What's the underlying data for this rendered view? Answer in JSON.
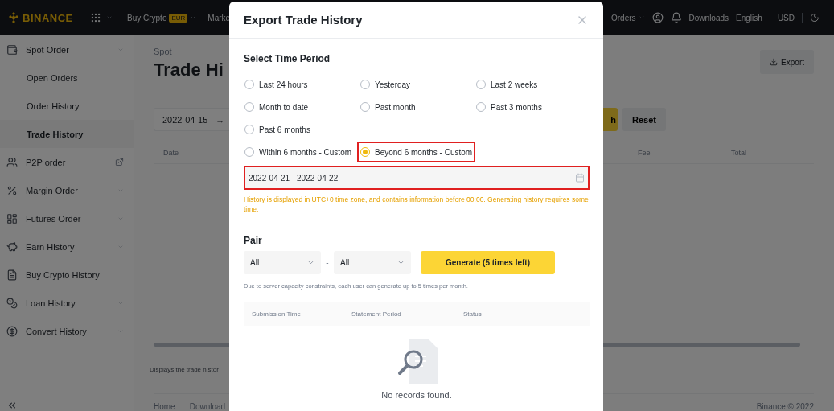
{
  "header": {
    "logo": "BINANCE",
    "nav": [
      {
        "label": "Buy Crypto",
        "badge": "EUR",
        "caret": true
      },
      {
        "label": "Marke",
        "caret": false
      }
    ],
    "orders": "Orders",
    "downloads": "Downloads",
    "language": "English",
    "currency": "USD"
  },
  "sidebar": {
    "items": [
      {
        "label": "Spot Order",
        "kind": "dropdown",
        "selected": false,
        "children": [
          {
            "label": "Open Orders",
            "selected": false
          },
          {
            "label": "Order History",
            "selected": false
          },
          {
            "label": "Trade History",
            "selected": true
          }
        ]
      },
      {
        "label": "P2P order",
        "kind": "external",
        "selected": false
      },
      {
        "label": "Margin Order",
        "kind": "dropdown",
        "selected": false
      },
      {
        "label": "Futures Order",
        "kind": "dropdown",
        "selected": false
      },
      {
        "label": "Earn History",
        "kind": "dropdown",
        "selected": false
      },
      {
        "label": "Buy Crypto History",
        "kind": "link",
        "selected": false
      },
      {
        "label": "Loan History",
        "kind": "dropdown",
        "selected": false
      },
      {
        "label": "Convert History",
        "kind": "dropdown",
        "selected": false
      }
    ]
  },
  "main": {
    "breadcrumb": "Spot",
    "title": "Trade Hi",
    "export": "Export",
    "filter": {
      "date_from": "2022-04-15",
      "arrow": "→",
      "search": "h",
      "reset": "Reset"
    },
    "table": {
      "columns": [
        "Date",
        "Fee",
        "Total"
      ]
    },
    "note": "Displays the trade histor",
    "footer": {
      "links": [
        "Home",
        "Download"
      ],
      "copyright": "Binance © 2022"
    }
  },
  "modal": {
    "title": "Export Trade History",
    "time_period": {
      "label": "Select Time Period",
      "rows": [
        [
          {
            "label": "Last 24 hours",
            "selected": false,
            "highlighted": false
          },
          {
            "label": "Yesterday",
            "selected": false,
            "highlighted": false
          },
          {
            "label": "Last 2 weeks",
            "selected": false,
            "highlighted": false
          }
        ],
        [
          {
            "label": "Month to date",
            "selected": false,
            "highlighted": false
          },
          {
            "label": "Past month",
            "selected": false,
            "highlighted": false
          },
          {
            "label": "Past 3 months",
            "selected": false,
            "highlighted": false
          }
        ],
        [
          {
            "label": "Past 6 months",
            "selected": false,
            "highlighted": false
          }
        ],
        [
          {
            "label": "Within 6 months - Custom",
            "selected": false,
            "highlighted": false
          },
          {
            "label": "Beyond 6 months - Custom",
            "selected": true,
            "highlighted": true
          }
        ]
      ]
    },
    "date_range": {
      "value": "2022-04-21 - 2022-04-22",
      "highlighted": true
    },
    "warning": "History is displayed in UTC+0 time zone, and contains information before 00:00. Generating history requires some time.",
    "pair": {
      "label": "Pair",
      "base": "All",
      "separator": "-",
      "quote": "All"
    },
    "generate": "Generate (5 times left)",
    "limit_note": "Due to server capacity constraints, each user can generate up to 5 times per month.",
    "records": {
      "columns": [
        "Submission Time",
        "Statement Period",
        "Status"
      ],
      "empty": "No records found."
    }
  }
}
